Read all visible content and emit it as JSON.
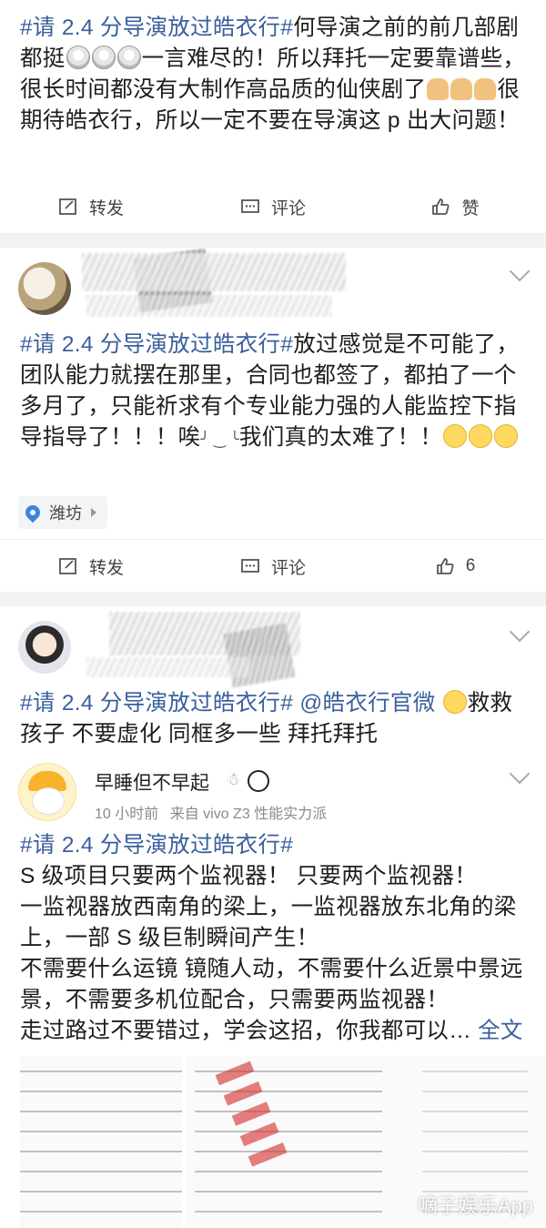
{
  "post1": {
    "text_parts": {
      "tag": "#请 2.4 分导演放过皓衣行#",
      "a": "何导演之前的前几部剧都挺",
      "b": "一言难尽的！所以拜托一定要靠谱些，很长时间都没有大制作高品质的仙侠剧了",
      "c": "很期待皓衣行，所以一定不要在导演这 p 出大问题！"
    }
  },
  "post2": {
    "location": "潍坊",
    "text_parts": {
      "tag": "#请 2.4 分导演放过皓衣行#",
      "a": "放过感觉是不可能了，团队能力就摆在那里，合同也都签了，都拍了一个多月了，只能祈求有个专业能力强的人能监控下指导指导了！！！唉",
      "b": "╯ ‿ ╰",
      "c": "我们真的太难了！！"
    },
    "like_count": "6"
  },
  "post3": {
    "text_parts": {
      "tag": "#请 2.4 分导演放过皓衣行#",
      "mention": "@皓衣行官微",
      "a": "救救孩子 不要虚化 同框多一些 拜托拜托"
    }
  },
  "post4": {
    "username": "早睡但不早起",
    "time": "10 小时前",
    "source": "来自 vivo Z3 性能实力派",
    "tag": "#请 2.4 分导演放过皓衣行#",
    "line1": "S 级项目只要两个监视器！ 只要两个监视器！",
    "line2": "一监视器放西南角的梁上，一监视器放东北角的梁上，一部 S 级巨制瞬间产生！",
    "line3": "不需要什么运镜 镜随人动，不需要什么近景中景远景，不需要多机位配合，只需要两监视器！",
    "line4": "走过路过不要错过，学会这招，你我都可以…",
    "full_text_link": "全文",
    "watermark": "嘀子娱乐App"
  },
  "actions": {
    "repost": "转发",
    "comment": "评论",
    "like": "赞"
  },
  "colors": {
    "link": "#3a5f9c",
    "text": "#1e1e1e",
    "separator": "#f2f2f2"
  }
}
